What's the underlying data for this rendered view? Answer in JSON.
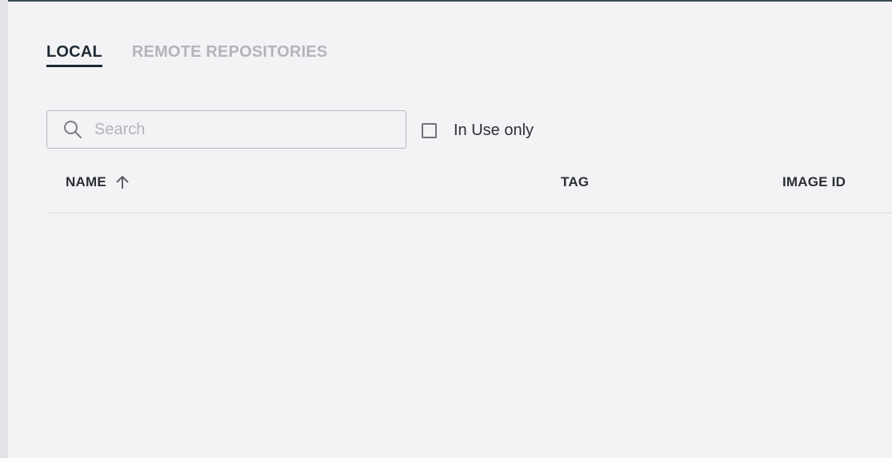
{
  "tabs": [
    {
      "label": "LOCAL",
      "active": true
    },
    {
      "label": "REMOTE REPOSITORIES",
      "active": false
    }
  ],
  "search": {
    "placeholder": "Search",
    "value": "",
    "icon": "search-icon"
  },
  "filter": {
    "label": "In Use only",
    "checked": false
  },
  "table": {
    "columns": [
      {
        "label": "NAME",
        "sort": "ascending",
        "icon": "arrow-up-icon"
      },
      {
        "label": "TAG"
      },
      {
        "label": "IMAGE ID"
      }
    ],
    "rows": []
  },
  "colors": {
    "top_border": "#374a52",
    "active_tab": "#1e2a33",
    "inactive_tab": "#b3b5ba",
    "background": "#f3f3f5"
  }
}
